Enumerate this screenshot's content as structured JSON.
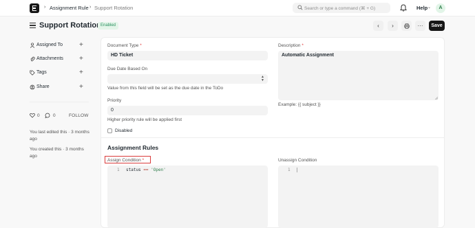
{
  "navbar": {
    "breadcrumb_1": "Assignment Rule",
    "breadcrumb_2": "Support Rotation",
    "search_placeholder": "Search or type a command (⌘ + G)",
    "help_label": "Help",
    "avatar_initial": "A"
  },
  "header": {
    "title": "Support Rotation",
    "status": "Enabled",
    "save_label": "Save"
  },
  "sidebar": {
    "items": [
      {
        "label": "Assigned To",
        "icon": "user-icon"
      },
      {
        "label": "Attachments",
        "icon": "paperclip-icon"
      },
      {
        "label": "Tags",
        "icon": "tag-icon"
      },
      {
        "label": "Share",
        "icon": "share-icon"
      }
    ],
    "likes_count": "0",
    "comments_count": "0",
    "follow_label": "FOLLOW",
    "last_edited": "You last edited this · 3 months ago",
    "created": "You created this · 3 months ago"
  },
  "form": {
    "document_type_label": "Document Type",
    "document_type_value": "HD Ticket",
    "due_date_label": "Due Date Based On",
    "due_date_help": "Value from this field will be set as the due date in the ToDo",
    "priority_label": "Priority",
    "priority_value": "0",
    "priority_help": "Higher priority rule will be applied first",
    "disabled_label": "Disabled",
    "description_label": "Description",
    "description_value": "Automatic Assignment",
    "description_help": "Example: {{ subject }}",
    "section_title": "Assignment Rules",
    "assign_condition_label": "Assign Condition",
    "assign_line_number": "1",
    "assign_code_var": "status",
    "assign_code_op": "==",
    "assign_code_str": "'Open'",
    "unassign_condition_label": "Unassign Condition",
    "unassign_line_number": "1"
  },
  "colors": {
    "accent": "#171717",
    "status_green": "#278f5e",
    "highlight_red": "#d93a3a",
    "required_red": "#e03636"
  }
}
